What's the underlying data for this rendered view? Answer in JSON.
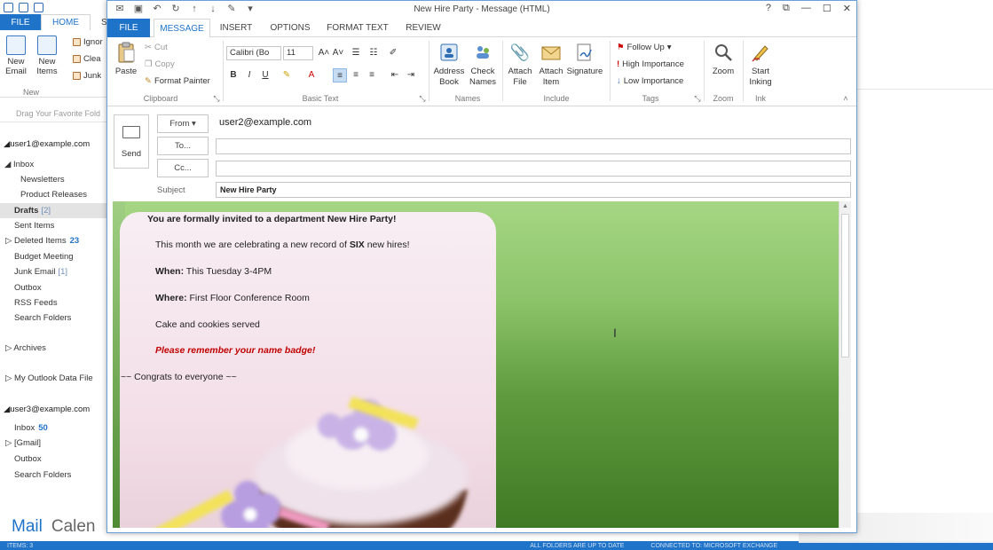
{
  "main_window": {
    "tabs": {
      "file": "FILE",
      "home": "HOME",
      "partial": "S"
    },
    "ribbon": {
      "new_email": "New Email",
      "new_items": "New Items",
      "ignore": "Ignor",
      "clean": "Clea",
      "junk": "Junk",
      "group_new": "New"
    },
    "favorites_hint": "Drag Your Favorite Fold",
    "accounts": [
      {
        "email": "user1@example.com",
        "folders": [
          {
            "label": "Inbox"
          },
          {
            "label": "Newsletters"
          },
          {
            "label": "Product Releases"
          },
          {
            "label": "Drafts",
            "count": "[2]"
          },
          {
            "label": "Sent Items"
          },
          {
            "label": "Deleted Items",
            "count": "23"
          },
          {
            "label": "Budget Meeting"
          },
          {
            "label": "Junk Email",
            "count": "[1]"
          },
          {
            "label": "Outbox"
          },
          {
            "label": "RSS Feeds"
          },
          {
            "label": "Search Folders"
          }
        ]
      },
      {
        "email": "user3@example.com",
        "folders": [
          {
            "label": "Inbox",
            "count": "50"
          },
          {
            "label": "[Gmail]"
          },
          {
            "label": "Outbox"
          },
          {
            "label": "Search Folders"
          }
        ]
      }
    ],
    "archives": "Archives",
    "my_data_file": "My Outlook Data File",
    "nav": {
      "mail": "Mail",
      "calendar": "Calen"
    },
    "status": {
      "items": "ITEMS: 3",
      "sync": "ALL FOLDERS ARE UP TO DATE",
      "connection": "CONNECTED TO: MICROSOFT EXCHANGE"
    }
  },
  "compose": {
    "title": "New Hire Party - Message (HTML)",
    "window_controls": {
      "help": "?",
      "restore": "⧉",
      "minimize": "—",
      "maximize": "☐",
      "close": "✕"
    },
    "tabs": {
      "file": "FILE",
      "message": "MESSAGE",
      "insert": "INSERT",
      "options": "OPTIONS",
      "format_text": "FORMAT TEXT",
      "review": "REVIEW"
    },
    "ribbon": {
      "paste": "Paste",
      "cut": "Cut",
      "copy": "Copy",
      "format_painter": "Format Painter",
      "clipboard": "Clipboard",
      "font_name": "Calibri (Bo",
      "font_size": "11",
      "basic_text": "Basic Text",
      "address_book": "Address Book",
      "check_names": "Check Names",
      "names": "Names",
      "attach_file": "Attach File",
      "attach_item": "Attach Item",
      "signature": "Signature",
      "include": "Include",
      "follow_up": "Follow Up",
      "high_importance": "High Importance",
      "low_importance": "Low Importance",
      "tags": "Tags",
      "zoom": "Zoom",
      "zoom_group": "Zoom",
      "start_inking": "Start Inking",
      "ink": "Ink"
    },
    "header": {
      "send": "Send",
      "from_btn": "From",
      "from_value": "user2@example.com",
      "to_btn": "To...",
      "cc_btn": "Cc...",
      "subject_label": "Subject",
      "subject_value": "New Hire Party",
      "to_value": "",
      "cc_value": ""
    },
    "body": {
      "heading": "You are formally invited to a department New Hire Party!",
      "line1_pre": "This month we are celebrating a new record of ",
      "line1_bold": "SIX",
      "line1_post": " new hires!",
      "when_label": "When:",
      "when_value": " This Tuesday 3-4PM",
      "where_label": "Where:",
      "where_value": "  First Floor Conference Room",
      "snacks": "Cake and cookies served",
      "reminder": "Please remember your name badge!",
      "congrats": "~~ Congrats to everyone  ~~"
    }
  }
}
